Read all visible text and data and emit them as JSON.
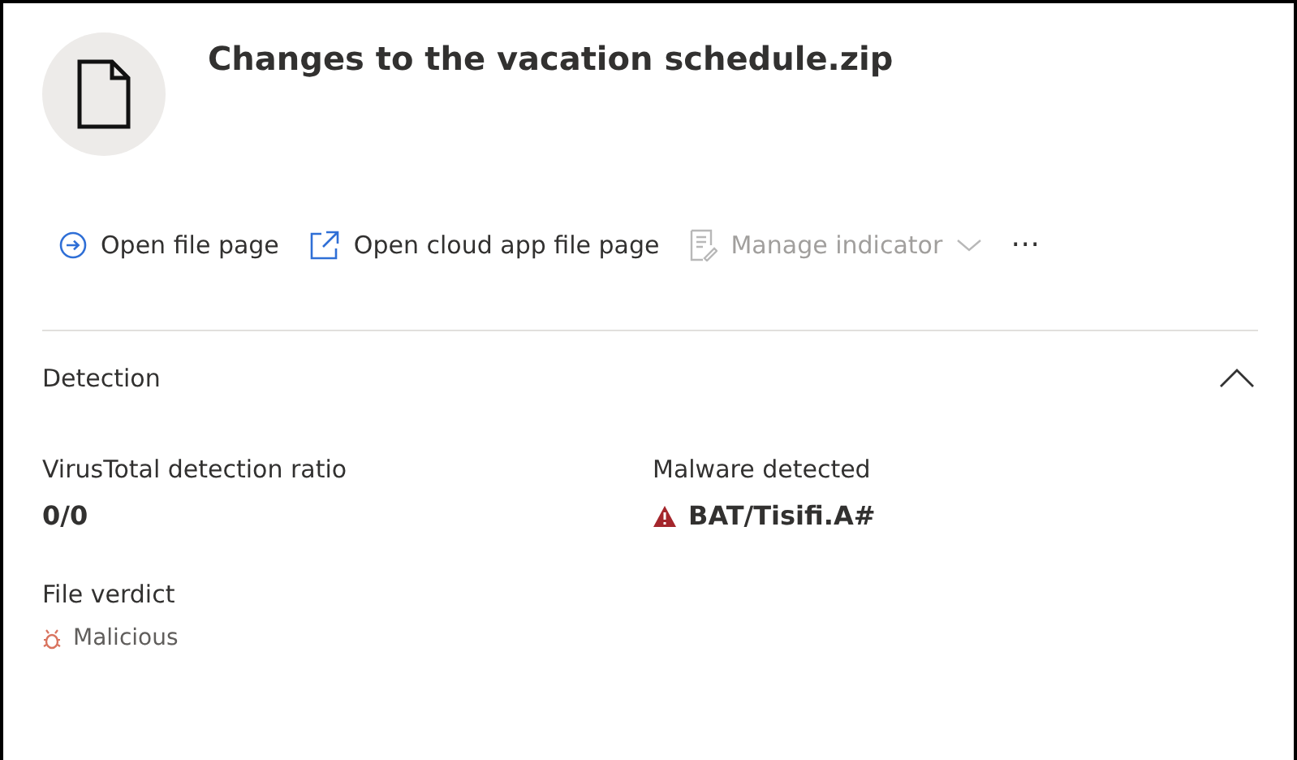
{
  "title": "Changes to the vacation schedule.zip",
  "actions": [
    {
      "kind": "open",
      "label": "Open file page",
      "disabled": false
    },
    {
      "kind": "external",
      "label": "Open cloud app file page",
      "disabled": false
    },
    {
      "kind": "indicator",
      "label": "Manage indicator",
      "disabled": true
    },
    {
      "kind": "more",
      "label": "⋯",
      "disabled": false
    }
  ],
  "section": {
    "title": "Detection",
    "expanded": true,
    "fields": [
      {
        "kind": "plain",
        "label": "VirusTotal detection ratio",
        "value": "0/0"
      },
      {
        "kind": "malware",
        "label": "Malware detected",
        "value": "BAT/Tisifi.A#"
      },
      {
        "kind": "verdict",
        "label": "File verdict",
        "value": "Malicious"
      }
    ]
  }
}
